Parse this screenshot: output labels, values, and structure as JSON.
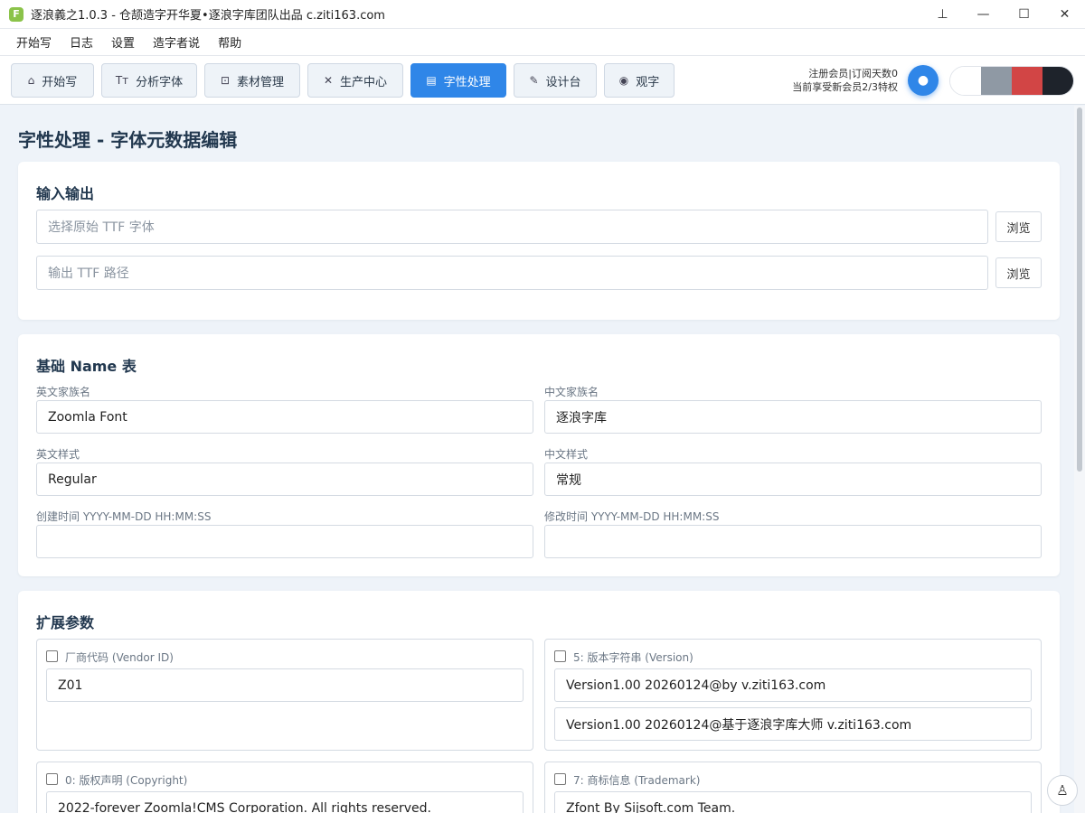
{
  "window": {
    "logo_letter": "F",
    "title": "逐浪義之1.0.3 - 仓颉造字开华夏•逐浪字库团队出品 c.ziti163.com",
    "pin": "⊥",
    "minimize": "—",
    "maximize": "☐",
    "close": "✕"
  },
  "menu": [
    "开始写",
    "日志",
    "设置",
    "造字者说",
    "帮助"
  ],
  "toolbar": {
    "tabs": [
      {
        "label": "开始写",
        "icon": "⌂"
      },
      {
        "label": "分析字体",
        "icon": "Tт"
      },
      {
        "label": "素材管理",
        "icon": "⊡"
      },
      {
        "label": "生产中心",
        "icon": "✕"
      },
      {
        "label": "字性处理",
        "icon": "▤"
      },
      {
        "label": "设计台",
        "icon": "✎"
      },
      {
        "label": "观字",
        "icon": "◉"
      }
    ],
    "active_index": 4,
    "member_line1": "注册会员|订阅天数0",
    "member_line2": "当前享受新会员2/3特权",
    "theme_button_glyph": "●",
    "swatch_colors": [
      "#ffffff",
      "#8f99a4",
      "#d24545",
      "#1e232b"
    ]
  },
  "page": {
    "title": "字性处理 - 字体元数据编辑"
  },
  "io": {
    "title": "输入输出",
    "source_placeholder": "选择原始 TTF 字体",
    "output_placeholder": "输出 TTF 路径",
    "browse_label": "浏览"
  },
  "name_table": {
    "title": "基础 Name 表",
    "en_family_label": "英文家族名",
    "en_family_value": "Zoomla Font",
    "zh_family_label": "中文家族名",
    "zh_family_value": "逐浪字库",
    "en_style_label": "英文样式",
    "en_style_value": "Regular",
    "zh_style_label": "中文样式",
    "zh_style_value": "常规",
    "created_label": "创建时间 YYYY-MM-DD HH:MM:SS",
    "created_value": "",
    "modified_label": "修改时间 YYYY-MM-DD HH:MM:SS",
    "modified_value": ""
  },
  "ext": {
    "title": "扩展参数",
    "vendor_label": "厂商代码 (Vendor ID)",
    "vendor_value": "Z01",
    "version_label": "5: 版本字符串 (Version)",
    "version_value_1": "Version1.00 20260124@by v.ziti163.com",
    "version_value_2": "Version1.00 20260124@基于逐浪字库大师 v.ziti163.com",
    "copyright_label": "0: 版权声明 (Copyright)",
    "copyright_value": "2022-forever Zoomla!CMS Corporation. All rights reserved.",
    "trademark_label": "7: 商标信息 (Trademark)",
    "trademark_value": "Zfont By Sijsoft.com Team."
  },
  "fab_icon": "♙"
}
